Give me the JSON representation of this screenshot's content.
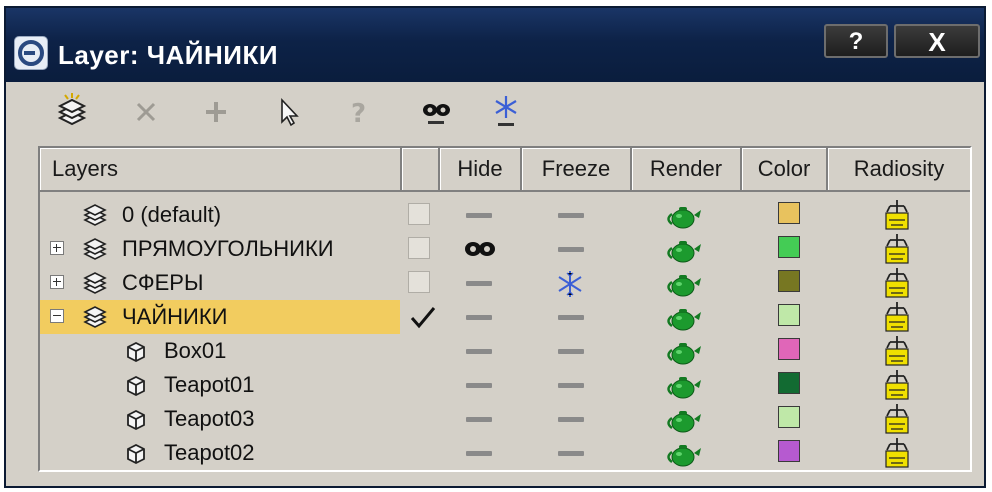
{
  "window": {
    "title": "Layer: ЧАЙНИКИ",
    "help_label": "?",
    "close_label": "X"
  },
  "toolbar": {
    "icons": [
      "create-new-layer-icon",
      "delete-layer-icon",
      "add-to-layer-icon",
      "select-objects-icon",
      "set-current-layer-icon",
      "hide-toggle-icon",
      "freeze-toggle-icon"
    ]
  },
  "columns": {
    "layers": "Layers",
    "hide": "Hide",
    "freeze": "Freeze",
    "render": "Render",
    "color": "Color",
    "radiosity": "Radiosity"
  },
  "rows": [
    {
      "kind": "layer",
      "label": "0 (default)",
      "expander": "none",
      "current": false,
      "hidden": false,
      "frozen": false,
      "color": "#e8c25e"
    },
    {
      "kind": "layer",
      "label": "ПРЯМОУГОЛЬНИКИ",
      "expander": "plus",
      "current": false,
      "hidden": true,
      "frozen": false,
      "color": "#44cc55"
    },
    {
      "kind": "layer",
      "label": "СФЕРЫ",
      "expander": "plus",
      "current": false,
      "hidden": false,
      "frozen": true,
      "color": "#777722"
    },
    {
      "kind": "layer",
      "label": "ЧАЙНИКИ",
      "expander": "minus",
      "current": true,
      "hidden": false,
      "frozen": false,
      "color": "#bfe8a8",
      "selected": true
    },
    {
      "kind": "object",
      "label": "Box01",
      "hidden": false,
      "frozen": false,
      "color": "#e066b8"
    },
    {
      "kind": "object",
      "label": "Teapot01",
      "hidden": false,
      "frozen": false,
      "color": "#126b32"
    },
    {
      "kind": "object",
      "label": "Teapot03",
      "hidden": false,
      "frozen": false,
      "color": "#bfe8a8"
    },
    {
      "kind": "object",
      "label": "Teapot02",
      "hidden": false,
      "frozen": false,
      "color": "#b65ad0"
    }
  ]
}
